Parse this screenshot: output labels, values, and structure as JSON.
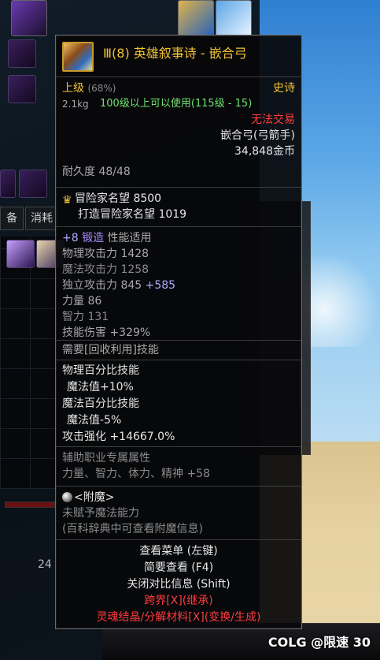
{
  "tooltip": {
    "item_name": "Ⅲ(8) 英雄叙事诗 - 嵌合弓",
    "grade": "上级",
    "grade_pct": "(68%)",
    "rarity": "史诗",
    "weight": "2.1kg",
    "level_req": "100级以上可以使用(115级 - 15)",
    "trade": "无法交易",
    "item_type": "嵌合弓(弓箭手)",
    "price": "34,848金币",
    "durability": "耐久度 48/48",
    "fame_label": "冒险家名望",
    "fame_value": "8500",
    "craft_fame_label": "打造冒险家名望",
    "craft_fame_value": "1019",
    "forge_prefix": "+8",
    "forge_label": "锻造",
    "forge_suffix": "性能适用",
    "stats": [
      {
        "label": "物理攻击力",
        "value": "1428"
      },
      {
        "label": "魔法攻击力",
        "value": "1258"
      },
      {
        "label": "独立攻击力",
        "value": "845",
        "bonus": "+585"
      },
      {
        "label": "力量",
        "value": "86"
      },
      {
        "label": "智力",
        "value": "131"
      },
      {
        "label": "技能伤害",
        "value": "+329%"
      }
    ],
    "recycle": "需要[回收利用]技能",
    "skills": [
      "物理百分比技能",
      " 魔法值+10%",
      "魔法百分比技能",
      " 魔法值-5%",
      "攻击强化 +14667.0%"
    ],
    "assist_title": "辅助职业专属属性",
    "assist_stats": "力量、智力、体力、精神 +58",
    "enchant_title": "<附魔>",
    "enchant_line1": "未赋予魔法能力",
    "enchant_line2": "(百科辞典中可查看附魔信息)",
    "actions": [
      {
        "label": "查看菜单 (左键)",
        "color": "#e6e6e6"
      },
      {
        "label": "简要查看 (F4)",
        "color": "#e6e6e6"
      },
      {
        "label": "关闭对比信息 (Shift)",
        "color": "#e6e6e6"
      },
      {
        "label": "跨界[X](继承)",
        "color": "#ff3c3c"
      },
      {
        "label": "灵魂结晶/分解材料[X](变换/生成)",
        "color": "#ff3c3c"
      }
    ]
  },
  "background": {
    "tab1": "备",
    "tab2": "消耗",
    "num_left": "24"
  },
  "watermark": "COLG @限速 30",
  "colors": {
    "gold": "#f1c232",
    "red": "#ff3c3c",
    "purple": "#a88cff",
    "green": "#6ee06e"
  }
}
